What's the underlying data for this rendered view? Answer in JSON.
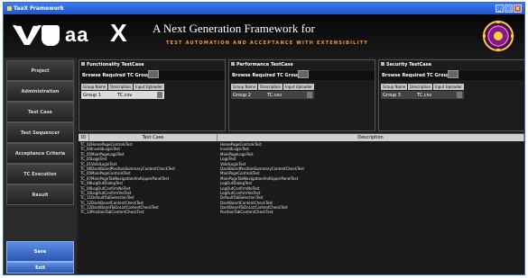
{
  "window": {
    "title": "TaaX Framework",
    "buttons": [
      "_",
      "□",
      "x"
    ]
  },
  "banner": {
    "logo_aa": "aa",
    "logo_x": "X",
    "headline": "A Next Generation Framework for",
    "tagline": "TEST AUTOMATION AND ACCEPTANCE WITH EXTENSIBILITY"
  },
  "sidebar": {
    "items": [
      {
        "label": "Project"
      },
      {
        "label": "Administration"
      },
      {
        "label": "Test Case"
      },
      {
        "label": "Test Sequencer"
      },
      {
        "label": "Acceptance Criteria"
      },
      {
        "label": "TC Execution"
      },
      {
        "label": "Result"
      }
    ],
    "save_label": "Save",
    "exit_label": "Exit"
  },
  "groups": [
    {
      "title": "Functionality TestCase",
      "browse": "Browse Required TC Group",
      "columns": [
        "Group Name",
        "Description",
        "Input Uploader"
      ],
      "row": {
        "name": "Group 1",
        "file": "TC.csv"
      }
    },
    {
      "title": "Performance TestCase",
      "browse": "Browse Required TC Group",
      "columns": [
        "Group Name",
        "Description",
        "Input Uploader"
      ],
      "row": {
        "name": "Group 2",
        "file": "TC.csv"
      }
    },
    {
      "title": "Security TestCase",
      "browse": "Browse Required TC Group",
      "columns": [
        "Group Name",
        "Description",
        "Input Uploader"
      ],
      "row": {
        "name": "Group 3",
        "file": "TC.csv"
      }
    }
  ],
  "table": {
    "headers": [
      "ID",
      "Test Case",
      "Description"
    ],
    "rows": [
      {
        "id": "TC_02",
        "tc": "HomePageControlsTest",
        "desc": "HomePageControlsTest"
      },
      {
        "id": "TC_04",
        "tc": "InvalidLoginTest",
        "desc": "InvalidLoginTest"
      },
      {
        "id": "TC_05",
        "tc": "MainPageLogoTest",
        "desc": "MainPageLogoTest"
      },
      {
        "id": "TC_05",
        "tc": "LogoTest",
        "desc": "LogoTest"
      },
      {
        "id": "TC_01",
        "tc": "ValidLoginTest",
        "desc": "ValidLoginTest"
      },
      {
        "id": "TC_06",
        "tc": "DashBoardPositionSummaryContentCheckTest",
        "desc": "DashBoardPositionSummaryContentCheckTest"
      },
      {
        "id": "TC_05",
        "tc": "MainPageControlsTest",
        "desc": "MainPageControlsTest"
      },
      {
        "id": "TC_07",
        "tc": "MainPageTabNavigationAndUpperPanelTest",
        "desc": "MainPageTabNavigationAndUpperPanelTest"
      },
      {
        "id": "TC_08",
        "tc": "LogOutDialogTest",
        "desc": "LogOutDialogTest"
      },
      {
        "id": "TC_09",
        "tc": "LogOutConfirmNoTest",
        "desc": "LogOutConfirmNoTest"
      },
      {
        "id": "TC_10",
        "tc": "LogOutConfirmYesTest",
        "desc": "LogOutConfirmYesTest"
      },
      {
        "id": "TC_11",
        "tc": "DefaultTabSelectionTest",
        "desc": "DefaultTabSelectionTest"
      },
      {
        "id": "TC_12",
        "tc": "DashBoardContentCheckTest",
        "desc": "DashBoardContentCheckTest"
      },
      {
        "id": "TC_12",
        "tc": "DashBoardToDoListContentCheckTest",
        "desc": "DashBoardToDoListContentCheckTest"
      },
      {
        "id": "TC_13",
        "tc": "PositionTabContentCheckTest",
        "desc": "PositionTabContentCheckTest"
      }
    ]
  }
}
